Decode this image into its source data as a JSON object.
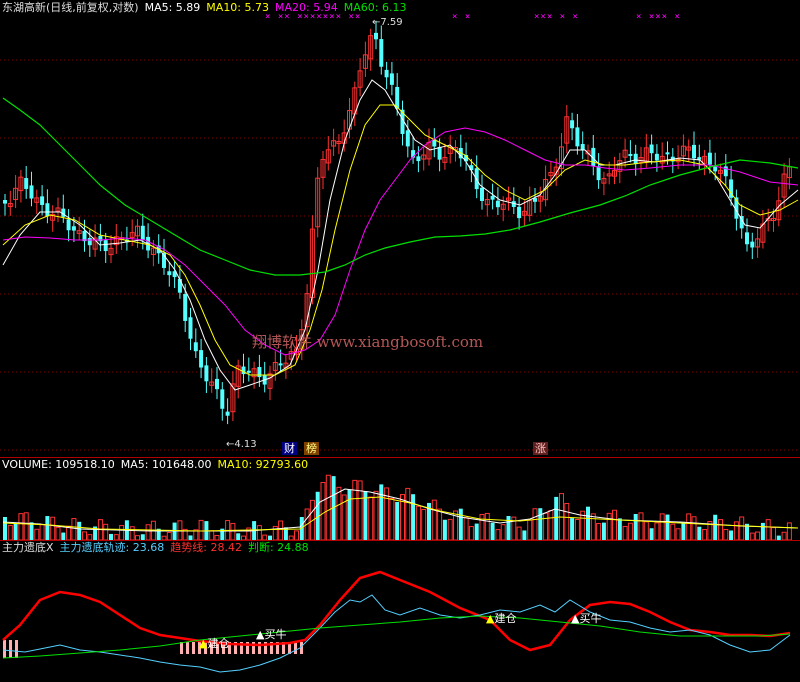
{
  "price_legend": {
    "title": "东湖高新(日线,前复权,对数)",
    "ma5": "MA5: 5.89",
    "ma10": "MA10: 5.73",
    "ma20": "MA20: 5.94",
    "ma60": "MA60: 6.13"
  },
  "volume_legend": {
    "volume": "VOLUME: 109518.10",
    "ma5": "MA5: 101648.00",
    "ma10": "MA10: 92793.60"
  },
  "indicator_legend": {
    "title": "主力遗底X",
    "track": "主力遗底轨迹: 23.68",
    "trend": "趋势线: 28.42",
    "judge": "判断: 24.88"
  },
  "price_annotations": {
    "high": "7.59",
    "low": "4.13"
  },
  "tags": {
    "cai": "财",
    "bang": "榜",
    "zhang": "涨"
  },
  "watermark": "翔博软件 www.xiangbosoft.com",
  "signals": {
    "build1": "建仓",
    "buy1": "买牛",
    "build2": "建仓",
    "buy2": "买牛"
  },
  "colors": {
    "up": "#ff3232",
    "down": "#54ffff",
    "ma5": "#ffffff",
    "ma10": "#ffff00",
    "ma20": "#ff00ff",
    "ma60": "#00e000",
    "trend": "#ff0000",
    "track": "#55d0ff",
    "judge": "#00e000",
    "background": "#000000"
  }
}
